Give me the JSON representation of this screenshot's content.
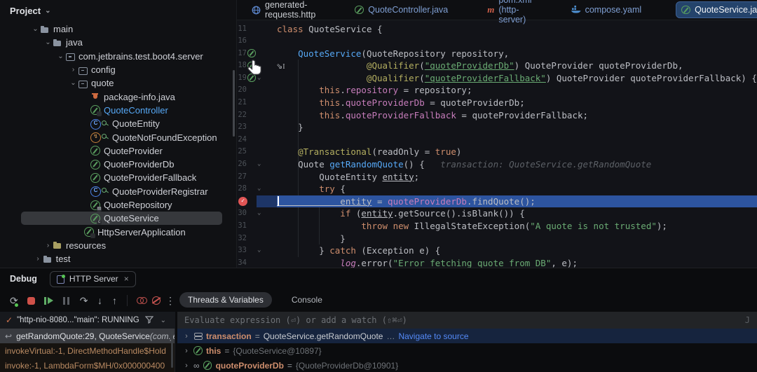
{
  "colors": {
    "accent_blue": "#3574F0",
    "exec_line": "#2D549F",
    "breakpoint_red": "#DB5C5C",
    "selected_tab_bg": "#24436B",
    "string_green": "#6AAB73",
    "keyword_orange": "#CF8E6D",
    "field_purple": "#C77DBB",
    "annotation_yellow": "#B3AE60",
    "link_blue": "#548AF7"
  },
  "project": {
    "header": "Project",
    "items": [
      {
        "label": "main",
        "icon": "folder",
        "level": 0,
        "chevron": "down"
      },
      {
        "label": "java",
        "icon": "folder",
        "level": 1,
        "chevron": "down"
      },
      {
        "label": "com.jetbrains.test.boot4.server",
        "icon": "pkg",
        "level": 2,
        "chevron": "down"
      },
      {
        "label": "config",
        "icon": "pkg",
        "level": 3,
        "chevron": "right"
      },
      {
        "label": "quote",
        "icon": "pkg",
        "level": 3,
        "chevron": "down"
      },
      {
        "label": "package-info.java",
        "icon": "pinfo",
        "level": 4,
        "chevron": "none"
      },
      {
        "label": "QuoteController",
        "icon": "bean-badge",
        "level": 4,
        "chevron": "none",
        "label_color": "#56a8f5"
      },
      {
        "label": "QuoteEntity",
        "icon": "class-key",
        "level": 4,
        "chevron": "none"
      },
      {
        "label": "QuoteNotFoundException",
        "icon": "exc-key",
        "level": 4,
        "chevron": "none"
      },
      {
        "label": "QuoteProvider",
        "icon": "bean",
        "level": 4,
        "chevron": "none"
      },
      {
        "label": "QuoteProviderDb",
        "icon": "bean",
        "level": 4,
        "chevron": "none"
      },
      {
        "label": "QuoteProviderFallback",
        "icon": "bean",
        "level": 4,
        "chevron": "none"
      },
      {
        "label": "QuoteProviderRegistrar",
        "icon": "class-key",
        "level": 4,
        "chevron": "none"
      },
      {
        "label": "QuoteRepository",
        "icon": "bean-badge-db",
        "level": 4,
        "chevron": "none"
      },
      {
        "label": "QuoteService",
        "icon": "bean-badge-c",
        "level": 4,
        "chevron": "none",
        "selected": true
      },
      {
        "label": "HttpServerApplication",
        "icon": "bean-badge",
        "level": 3.5,
        "chevron": "none"
      },
      {
        "label": "resources",
        "icon": "folder-res",
        "level": 1,
        "chevron": "right"
      },
      {
        "label": "test",
        "icon": "folder",
        "level": 0.2,
        "chevron": "right"
      }
    ]
  },
  "editor": {
    "tabs": [
      {
        "label": "generated-requests.http",
        "icon": "globe",
        "selected": false,
        "tint": false
      },
      {
        "label": "QuoteController.java",
        "icon": "bean",
        "selected": false,
        "tint": true
      },
      {
        "label": "pom.xml (http-server)",
        "icon": "maven",
        "selected": false,
        "tint": true
      },
      {
        "label": "compose.yaml",
        "icon": "docker",
        "selected": false,
        "tint": true
      },
      {
        "label": "QuoteService.java",
        "icon": "bean-c",
        "selected": true,
        "close": "×",
        "tint": false
      }
    ],
    "lines": [
      {
        "n": "11",
        "t": [
          [
            "kw",
            "class "
          ],
          [
            "pl",
            "QuoteService {"
          ]
        ]
      },
      {
        "n": "16",
        "t": []
      },
      {
        "n": "17",
        "g": "bean",
        "t": [
          [
            "decl",
            "    QuoteService"
          ],
          [
            "pl",
            "(QuoteRepository repository,"
          ]
        ]
      },
      {
        "n": "18",
        "g": "bean",
        "t": [
          [
            "ann",
            "                 @Qualifier"
          ],
          [
            "pl",
            "("
          ],
          [
            "strU",
            "\"quoteProviderDb\""
          ],
          [
            "pl",
            ") QuoteProvider quoteProviderDb,"
          ]
        ]
      },
      {
        "n": "19",
        "g": "bean",
        "fold": true,
        "t": [
          [
            "ann",
            "                 @Qualifier"
          ],
          [
            "pl",
            "("
          ],
          [
            "strU",
            "\"quoteProviderFallback\""
          ],
          [
            "pl",
            ") QuoteProvider quoteProviderFallback) {"
          ]
        ]
      },
      {
        "n": "20",
        "t": [
          [
            "kw",
            "        this"
          ],
          [
            "pl",
            "."
          ],
          [
            "field",
            "repository"
          ],
          [
            "pl",
            " = repository;"
          ]
        ]
      },
      {
        "n": "21",
        "t": [
          [
            "kw",
            "        this"
          ],
          [
            "pl",
            "."
          ],
          [
            "field",
            "quoteProviderDb"
          ],
          [
            "pl",
            " = quoteProviderDb;"
          ]
        ]
      },
      {
        "n": "22",
        "t": [
          [
            "kw",
            "        this"
          ],
          [
            "pl",
            "."
          ],
          [
            "field",
            "quoteProviderFallback"
          ],
          [
            "pl",
            " = quoteProviderFallback;"
          ]
        ]
      },
      {
        "n": "23",
        "t": [
          [
            "pl",
            "    }"
          ]
        ]
      },
      {
        "n": "24",
        "t": []
      },
      {
        "n": "25",
        "t": [
          [
            "ann",
            "    @Transactional"
          ],
          [
            "pl",
            "(readOnly = "
          ],
          [
            "kw",
            "true"
          ],
          [
            "pl",
            ")"
          ]
        ]
      },
      {
        "n": "26",
        "fold": true,
        "t": [
          [
            "pl",
            "    Quote "
          ],
          [
            "decl",
            "getRandomQuote"
          ],
          [
            "pl",
            "() {"
          ],
          [
            "hint",
            "   transaction: QuoteService.getRandomQuote"
          ]
        ]
      },
      {
        "n": "27",
        "t": [
          [
            "pl",
            "        QuoteEntity "
          ],
          [
            "und",
            "entity"
          ],
          [
            "pl",
            ";"
          ]
        ]
      },
      {
        "n": "28",
        "fold": true,
        "t": [
          [
            "kw",
            "        try"
          ],
          [
            "pl",
            " {"
          ]
        ]
      },
      {
        "n": "29",
        "bp": true,
        "exec": true,
        "t": [
          [
            "und",
            "            entity"
          ],
          [
            "pl",
            " = "
          ],
          [
            "field",
            "quoteProviderDb"
          ],
          [
            "pl",
            ".findQuote();"
          ]
        ]
      },
      {
        "n": "30",
        "fold": true,
        "t": [
          [
            "kw",
            "            if"
          ],
          [
            "pl",
            " ("
          ],
          [
            "und",
            "entity"
          ],
          [
            "pl",
            ".getSource().isBlank()) {"
          ]
        ]
      },
      {
        "n": "31",
        "t": [
          [
            "kw",
            "                throw new"
          ],
          [
            "pl",
            " IllegalStateException("
          ],
          [
            "str",
            "\"A quote is not trusted\""
          ],
          [
            "pl",
            ");"
          ]
        ]
      },
      {
        "n": "32",
        "t": [
          [
            "pl",
            "            }"
          ]
        ]
      },
      {
        "n": "33",
        "fold": true,
        "t": [
          [
            "pl",
            "        } "
          ],
          [
            "kw",
            "catch"
          ],
          [
            "pl",
            " (Exception e) {"
          ]
        ]
      },
      {
        "n": "34",
        "t": [
          [
            "logf",
            "            log"
          ],
          [
            "pl",
            ".error("
          ],
          [
            "str",
            "\"Error fetching quote from DB\""
          ],
          [
            "pl",
            ", e);"
          ]
        ]
      }
    ]
  },
  "debug": {
    "label": "Debug",
    "tab_label": "HTTP Server",
    "tab_close": "×",
    "toolbar": [
      {
        "name": "rerun",
        "glyph": "⟳"
      },
      {
        "name": "stop"
      },
      {
        "name": "resume"
      },
      {
        "name": "pause"
      },
      {
        "name": "step-over",
        "glyph": "↷"
      },
      {
        "name": "step-into",
        "glyph": "↓"
      },
      {
        "name": "step-out",
        "glyph": "↑"
      },
      {
        "name": "sep"
      },
      {
        "name": "view-breakpoints"
      },
      {
        "name": "mute-breakpoints"
      },
      {
        "name": "more",
        "glyph": "⋮"
      }
    ],
    "right_tabs": [
      "Threads & Variables",
      "Console"
    ],
    "thread": {
      "check": "✓",
      "text": "\"http-nio-8080...\"main\": RUNNING",
      "chevron": "⌄"
    },
    "evaluate": {
      "placeholder": "Evaluate expression (⏎) or add a watch (⇧⌘⏎)",
      "right_hint": "J"
    },
    "frames": [
      {
        "text": "getRandomQuote:29, QuoteService ",
        "suffix": "(com.je",
        "selected": true
      },
      {
        "text": "invokeVirtual:-1, DirectMethodHandle$Hold",
        "lib": true
      },
      {
        "text": "invoke:-1, LambdaForm$MH/0x000000400",
        "lib": true
      }
    ],
    "variables": [
      {
        "icon": "stack",
        "name": "transaction",
        "eq": "=",
        "value": "QuoteService.getRandomQuote",
        "ellipsis": "…",
        "link": "Navigate to source",
        "selected": true
      },
      {
        "icon": "bean",
        "name": "this",
        "eq": "=",
        "value_dim": "{QuoteService@10897}"
      },
      {
        "icon": "watch-bean",
        "watch": "∞",
        "name": "quoteProviderDb",
        "eq": "=",
        "value_dim": "{QuoteProviderDb@10901}"
      }
    ]
  }
}
